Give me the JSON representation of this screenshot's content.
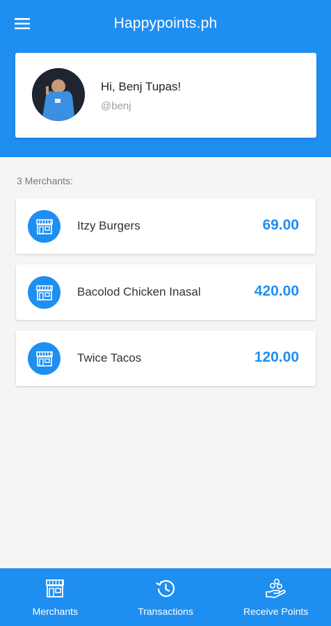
{
  "header": {
    "title": "Happypoints.ph"
  },
  "profile": {
    "greeting": "Hi, Benj Tupas!",
    "handle": "@benj"
  },
  "merchants_section": {
    "count_label": "3 Merchants:",
    "items": [
      {
        "name": "Itzy Burgers",
        "points": "69.00"
      },
      {
        "name": "Bacolod Chicken Inasal",
        "points": "420.00"
      },
      {
        "name": "Twice Tacos",
        "points": "120.00"
      }
    ]
  },
  "bottom_nav": {
    "items": [
      {
        "label": "Merchants",
        "icon": "store-icon"
      },
      {
        "label": "Transactions",
        "icon": "history-icon"
      },
      {
        "label": "Receive Points",
        "icon": "hand-receive-icon"
      }
    ]
  },
  "colors": {
    "primary": "#1f8ef1",
    "background": "#f5f5f5",
    "card": "#ffffff"
  }
}
